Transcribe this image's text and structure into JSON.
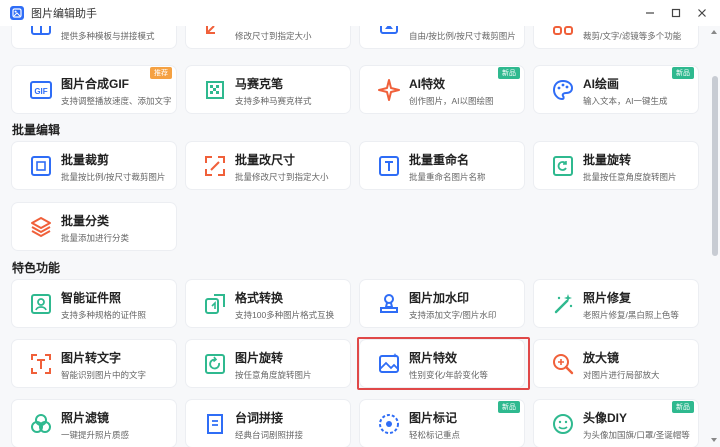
{
  "window": {
    "title": "图片编辑助手"
  },
  "top_row": [
    {
      "name": "",
      "desc": "提供多种模板与拼接模式",
      "icon": "collage-icon"
    },
    {
      "name": "",
      "desc": "修改尺寸到指定大小",
      "icon": "resize-icon"
    },
    {
      "name": "",
      "desc": "自由/按比例/按尺寸裁剪图片",
      "icon": "crop-icon"
    },
    {
      "name": "",
      "desc": "裁剪/文字/滤镜等多个功能",
      "icon": "multi-tools-icon"
    }
  ],
  "row_a": [
    {
      "name": "图片合成GIF",
      "desc": "支持调整播放速度、添加文字",
      "icon": "gif-icon",
      "badge": "推荐",
      "badge_type": "hot"
    },
    {
      "name": "马赛克笔",
      "desc": "支持多种马赛克样式",
      "icon": "mosaic-icon"
    },
    {
      "name": "AI特效",
      "desc": "创作图片，AI以图绘图",
      "icon": "sparkle-icon",
      "badge": "新品",
      "badge_type": "new"
    },
    {
      "name": "AI绘画",
      "desc": "输入文本，AI一键生成",
      "icon": "palette-icon",
      "badge": "新品",
      "badge_type": "new"
    }
  ],
  "sections": {
    "batch": "批量编辑",
    "special": "特色功能"
  },
  "batch": [
    {
      "name": "批量裁剪",
      "desc": "批量按比例/按尺寸裁剪图片",
      "icon": "batch-crop-icon"
    },
    {
      "name": "批量改尺寸",
      "desc": "批量修改尺寸到指定大小",
      "icon": "batch-resize-icon"
    },
    {
      "name": "批量重命名",
      "desc": "批量重命名图片名称",
      "icon": "rename-icon"
    },
    {
      "name": "批量旋转",
      "desc": "批量按任意角度旋转图片",
      "icon": "batch-rotate-icon"
    },
    {
      "name": "批量分类",
      "desc": "批量添加进行分类",
      "icon": "layers-icon"
    }
  ],
  "special_row1": [
    {
      "name": "智能证件照",
      "desc": "支持多种规格的证件照",
      "icon": "id-photo-icon"
    },
    {
      "name": "格式转换",
      "desc": "支持100多种图片格式互换",
      "icon": "convert-icon"
    },
    {
      "name": "图片加水印",
      "desc": "支持添加文字/图片水印",
      "icon": "watermark-icon"
    },
    {
      "name": "照片修复",
      "desc": "老照片修复/黑白照上色等",
      "icon": "magic-wand-icon"
    }
  ],
  "special_row2": [
    {
      "name": "图片转文字",
      "desc": "智能识别图片中的文字",
      "icon": "ocr-icon"
    },
    {
      "name": "图片旋转",
      "desc": "按任意角度旋转图片",
      "icon": "rotate-icon"
    },
    {
      "name": "照片特效",
      "desc": "性别变化/年龄变化等",
      "icon": "photo-effect-icon"
    },
    {
      "name": "放大镜",
      "desc": "对图片进行局部放大",
      "icon": "magnifier-icon"
    }
  ],
  "special_row3": [
    {
      "name": "照片滤镜",
      "desc": "一键提升照片质感",
      "icon": "filter-icon"
    },
    {
      "name": "台词拼接",
      "desc": "经典台词剧照拼接",
      "icon": "subtitle-icon"
    },
    {
      "name": "图片标记",
      "desc": "轻松标记重点",
      "icon": "mark-icon",
      "badge": "新品",
      "badge_type": "new"
    },
    {
      "name": "头像DIY",
      "desc": "为头像加国旗/口罩/圣诞帽等",
      "icon": "avatar-icon",
      "badge": "新品",
      "badge_type": "new"
    }
  ]
}
